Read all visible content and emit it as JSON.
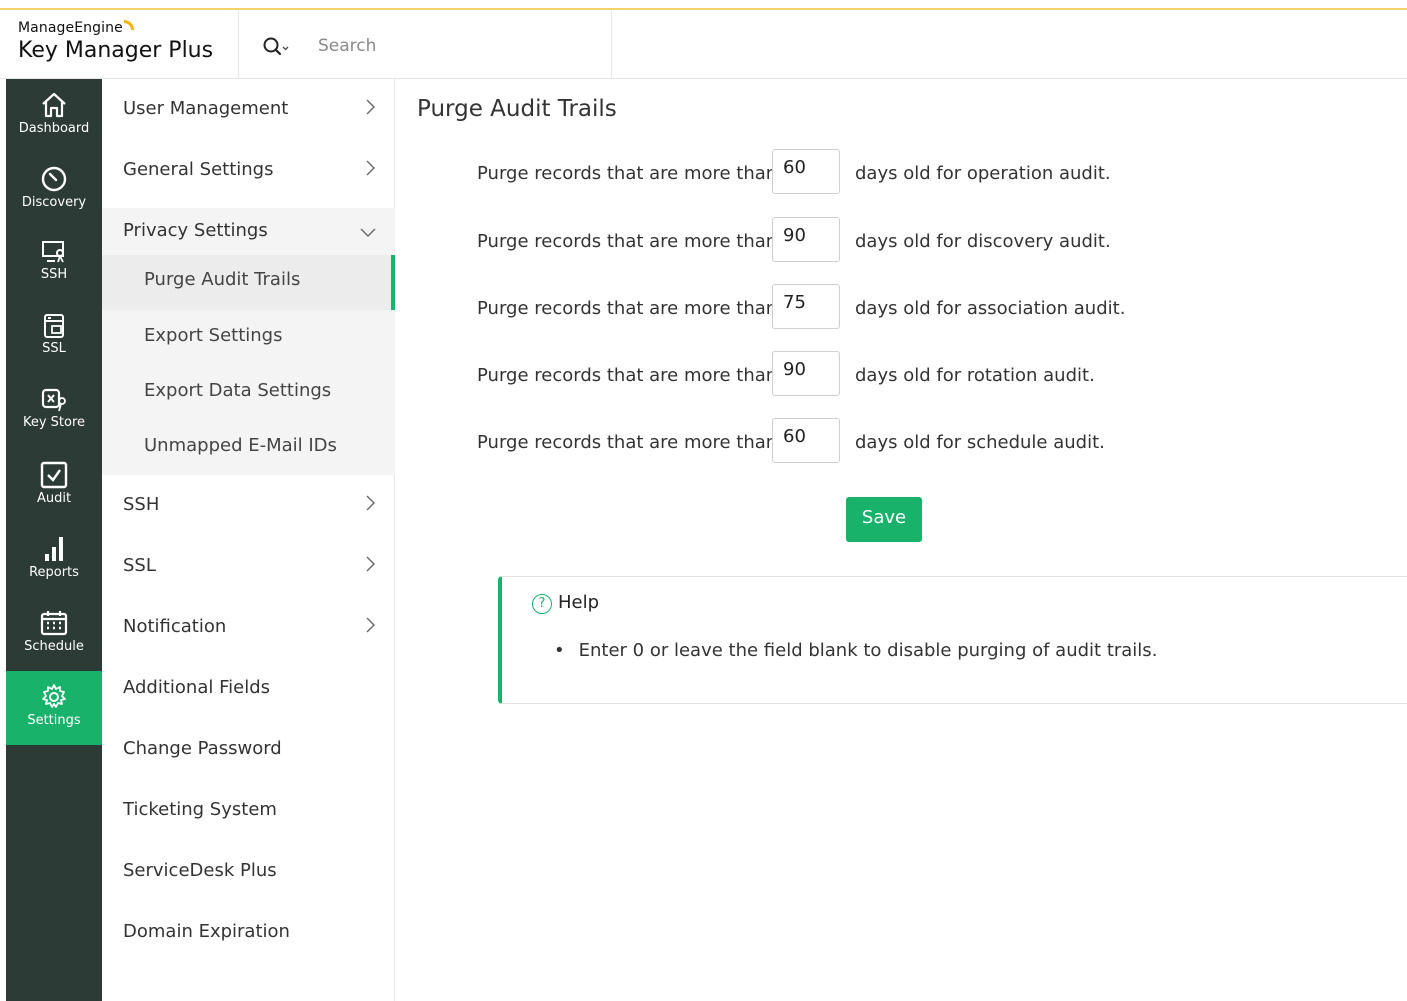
{
  "brand": {
    "company": "ManageEngine",
    "product": "Key Manager Plus"
  },
  "search": {
    "placeholder": "Search"
  },
  "rail": [
    {
      "label": "Dashboard",
      "icon": "home-icon"
    },
    {
      "label": "Discovery",
      "icon": "compass-icon"
    },
    {
      "label": "SSH",
      "icon": "ssh-icon"
    },
    {
      "label": "SSL",
      "icon": "ssl-icon"
    },
    {
      "label": "Key Store",
      "icon": "key-store-icon"
    },
    {
      "label": "Audit",
      "icon": "audit-check-icon"
    },
    {
      "label": "Reports",
      "icon": "bar-chart-icon"
    },
    {
      "label": "Schedule",
      "icon": "calendar-icon"
    },
    {
      "label": "Settings",
      "icon": "gear-icon",
      "active": true
    }
  ],
  "sidebar": {
    "items": [
      {
        "label": "User Management"
      },
      {
        "label": "General Settings"
      },
      {
        "label": "Privacy Settings",
        "expanded": true
      },
      {
        "label": "SSH"
      },
      {
        "label": "SSL"
      },
      {
        "label": "Notification"
      },
      {
        "label": "Additional Fields"
      },
      {
        "label": "Change Password"
      },
      {
        "label": "Ticketing System"
      },
      {
        "label": "ServiceDesk Plus"
      },
      {
        "label": "Domain Expiration"
      }
    ],
    "privacy_sub": [
      {
        "label": "Purge Audit Trails",
        "active": true
      },
      {
        "label": "Export Settings"
      },
      {
        "label": "Export Data Settings"
      },
      {
        "label": "Unmapped E-Mail IDs"
      }
    ]
  },
  "main": {
    "title": "Purge Audit Trails",
    "rows": [
      {
        "prefix": "Purge records that are more than",
        "value": "60",
        "suffix": "days old for operation audit."
      },
      {
        "prefix": "Purge records that are more than",
        "value": "90",
        "suffix": "days old for discovery audit."
      },
      {
        "prefix": "Purge records that are more than",
        "value": "75",
        "suffix": "days old for association audit."
      },
      {
        "prefix": "Purge records that are more than",
        "value": "90",
        "suffix": "days old for rotation audit."
      },
      {
        "prefix": "Purge records that are more than",
        "value": "60",
        "suffix": "days old for schedule audit."
      }
    ],
    "save_label": "Save",
    "help": {
      "title": "Help",
      "icon_glyph": "?",
      "items": [
        "Enter 0 or leave the field blank to disable purging of audit trails."
      ]
    }
  },
  "colors": {
    "accent": "#18b26b",
    "rail_bg": "#2d3b36",
    "top_line": "#f2d36b"
  }
}
